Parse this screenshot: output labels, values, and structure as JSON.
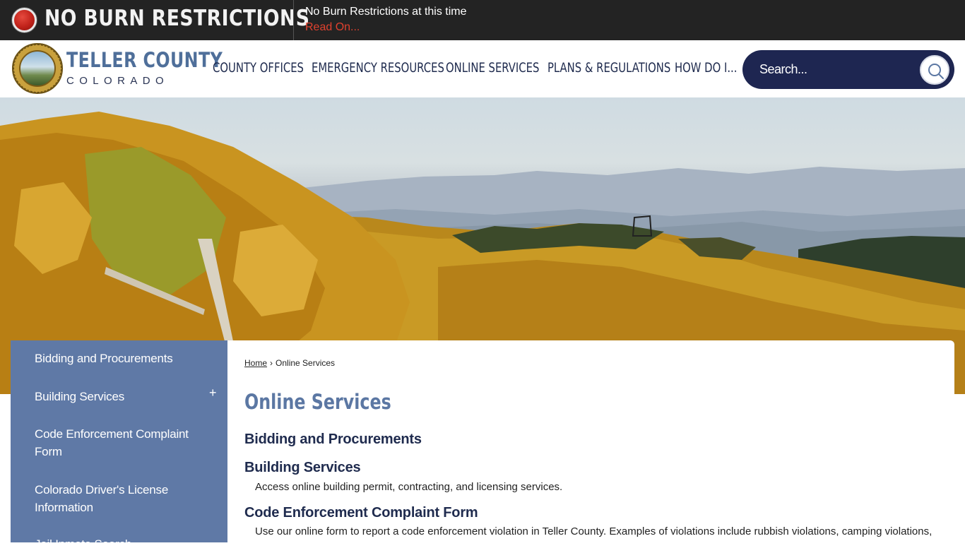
{
  "alert": {
    "title": "NO BURN RESTRICTIONS",
    "message": "No Burn Restrictions at this time",
    "link": "Read On..."
  },
  "logo": {
    "county": "TELLER COUNTY",
    "state": "COLORADO"
  },
  "nav": {
    "items": [
      "COUNTY OFFICES",
      "EMERGENCY RESOURCES",
      "ONLINE SERVICES",
      "PLANS & REGULATIONS",
      "HOW DO I..."
    ]
  },
  "search": {
    "placeholder": "Search..."
  },
  "sidebar": {
    "items": [
      "Bidding and Procurements",
      "Building Services",
      "Code Enforcement Complaint Form",
      "Colorado Driver's License Information",
      "Jail Inmate Search"
    ],
    "expand_label": "+"
  },
  "breadcrumb": {
    "home": "Home",
    "separator": "›",
    "current": "Online Services"
  },
  "main": {
    "title": "Online Services",
    "services": [
      {
        "title": "Bidding and Procurements",
        "description": ""
      },
      {
        "title": "Building Services",
        "description": "Access online building permit, contracting, and licensing services."
      },
      {
        "title": "Code Enforcement Complaint Form",
        "description": "Use our online form to report a code enforcement violation in Teller County. Examples of violations include rubbish violations, camping violations,"
      }
    ]
  },
  "colors": {
    "alert_bg": "#232323",
    "alert_red": "#e0412e",
    "navy": "#1e2651",
    "brand_blue": "#5b77a3",
    "sidebar_bg": "#5f79a6"
  },
  "icons": {
    "alert": "record-dot-icon",
    "search": "search-icon",
    "expand": "plus-icon"
  }
}
